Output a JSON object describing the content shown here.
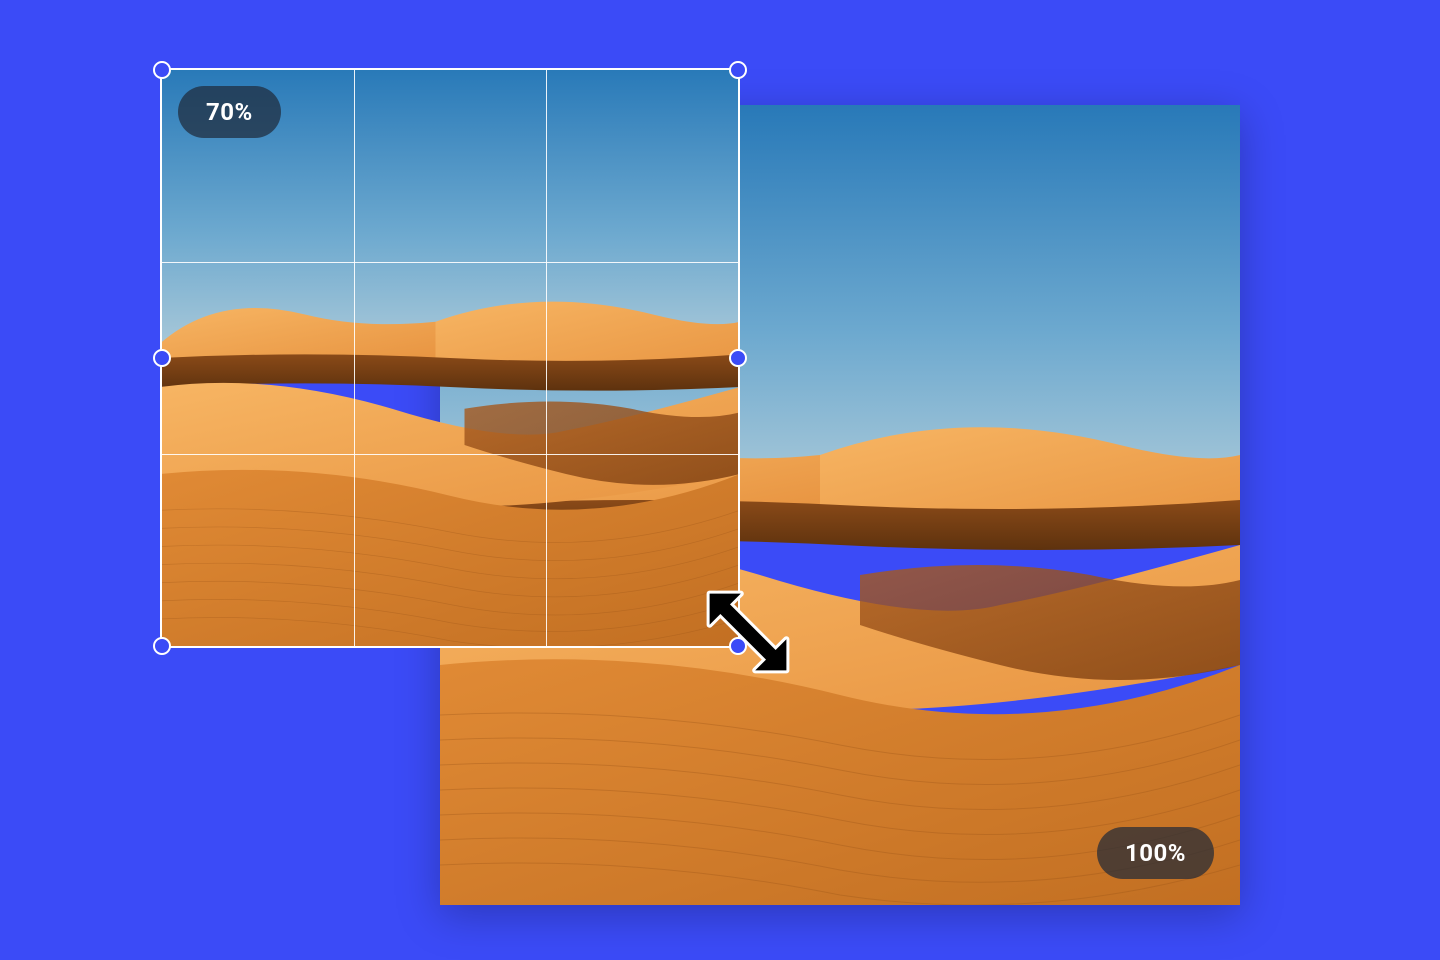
{
  "editor": {
    "resized_image": {
      "scale_label": "70%",
      "scale_percent": 70,
      "grid": "thirds"
    },
    "original_image": {
      "scale_label": "100%",
      "scale_percent": 100
    },
    "background_color": "#3B4BF7",
    "selection": {
      "handle_color": "#3B4BF7",
      "handle_border": "#ffffff",
      "handles": [
        "top-left",
        "top-right",
        "bottom-left",
        "bottom-right",
        "mid-left",
        "mid-right"
      ]
    },
    "cursor": "resize-diagonal"
  }
}
